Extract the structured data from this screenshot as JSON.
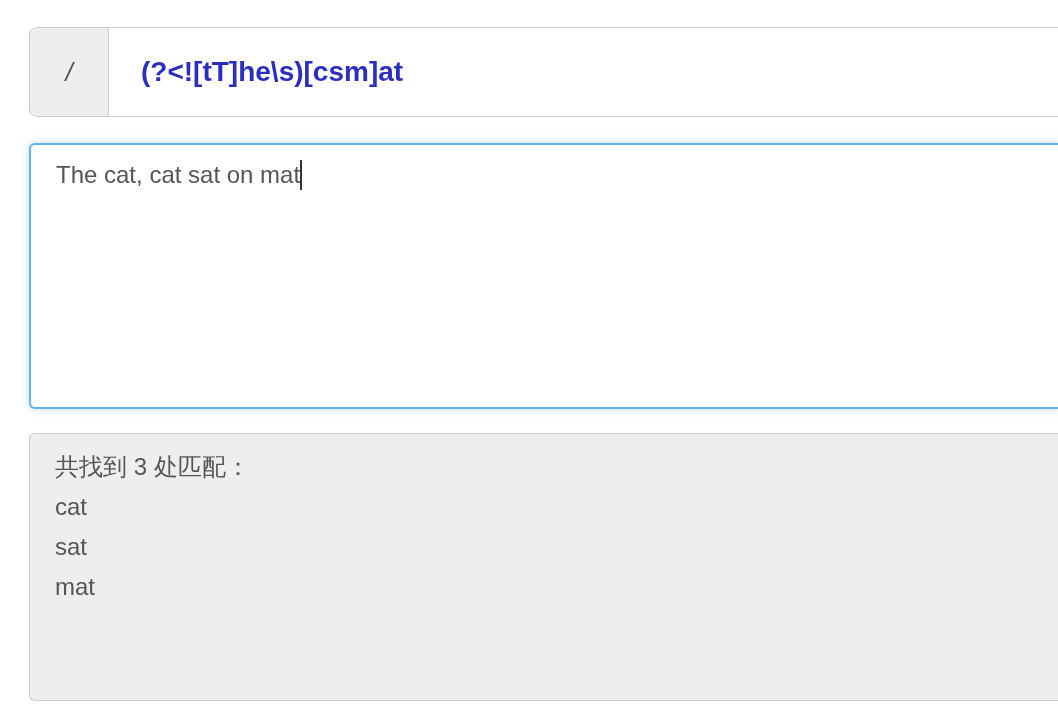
{
  "regex_bar": {
    "delimiter": "/",
    "pattern": "(?<![tT]he\\s)[csm]at"
  },
  "test_text": {
    "value": "The cat, cat sat on mat",
    "focused": true
  },
  "results": {
    "summary": "共找到 3 处匹配：",
    "matches": [
      "cat",
      "sat",
      "mat"
    ]
  }
}
